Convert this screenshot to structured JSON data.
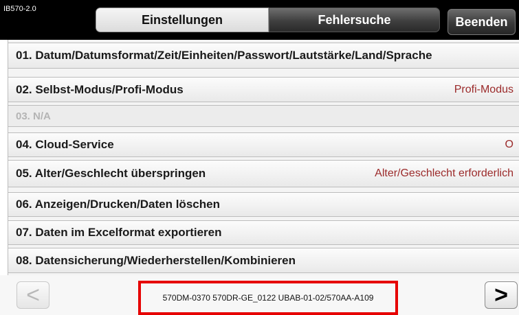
{
  "header": {
    "model": "IB570-2.0",
    "tabs": [
      {
        "label": "Einstellungen",
        "active": true
      },
      {
        "label": "Fehlersuche",
        "active": false
      }
    ],
    "exit_label": "Beenden"
  },
  "settings": [
    {
      "label": "01. Datum/Datumsformat/Zeit/Einheiten/Passwort/Lautstärke/Land/Sprache",
      "value": ""
    },
    {
      "label": "02. Selbst-Modus/Profi-Modus",
      "value": "Profi-Modus"
    },
    {
      "label": "03. N/A",
      "value": "",
      "disabled": true
    },
    {
      "label": "04. Cloud-Service",
      "value": "O"
    },
    {
      "label": "05. Alter/Geschlecht überspringen",
      "value": "Alter/Geschlecht erforderlich"
    },
    {
      "label": "06. Anzeigen/Drucken/Daten löschen",
      "value": ""
    },
    {
      "label": "07. Daten im Excelformat exportieren",
      "value": ""
    },
    {
      "label": "08. Datensicherung/Wiederherstellen/Kombinieren",
      "value": ""
    }
  ],
  "footer": {
    "prev_icon": "<",
    "next_icon": ">",
    "version": "570DM-0370 570DR-GE_0122 UBAB-01-02/570AA-A109"
  },
  "colors": {
    "value_text": "#9b2a2a",
    "highlight_border": "#e60000"
  }
}
